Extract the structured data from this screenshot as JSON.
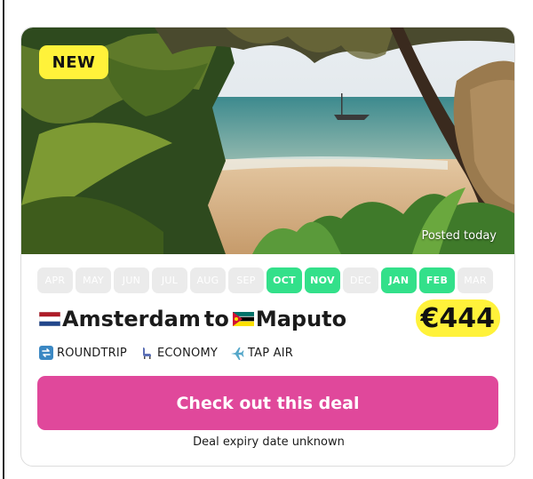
{
  "badge": "NEW",
  "posted": "Posted today",
  "months": [
    {
      "label": "APR",
      "active": false
    },
    {
      "label": "MAY",
      "active": false
    },
    {
      "label": "JUN",
      "active": false
    },
    {
      "label": "JUL",
      "active": false
    },
    {
      "label": "AUG",
      "active": false
    },
    {
      "label": "SEP",
      "active": false
    },
    {
      "label": "OCT",
      "active": true
    },
    {
      "label": "NOV",
      "active": true
    },
    {
      "label": "DEC",
      "active": false
    },
    {
      "label": "JAN",
      "active": true
    },
    {
      "label": "FEB",
      "active": true
    },
    {
      "label": "MAR",
      "active": false
    }
  ],
  "route": {
    "origin": "Amsterdam",
    "connector": "to",
    "destination": "Maputo"
  },
  "price": "€444",
  "tags": {
    "trip": "ROUNDTRIP",
    "cabin": "ECONOMY",
    "airline": "TAP AIR"
  },
  "cta": "Check out this deal",
  "expiry": "Deal expiry date unknown",
  "colors": {
    "accent": "#e0489b",
    "highlight": "#fff23a",
    "month_active": "#33e08a",
    "month_inactive": "#ebebeb"
  },
  "icons": {
    "trip": "roundtrip-icon",
    "cabin": "seat-icon",
    "airline": "airplane-icon"
  }
}
